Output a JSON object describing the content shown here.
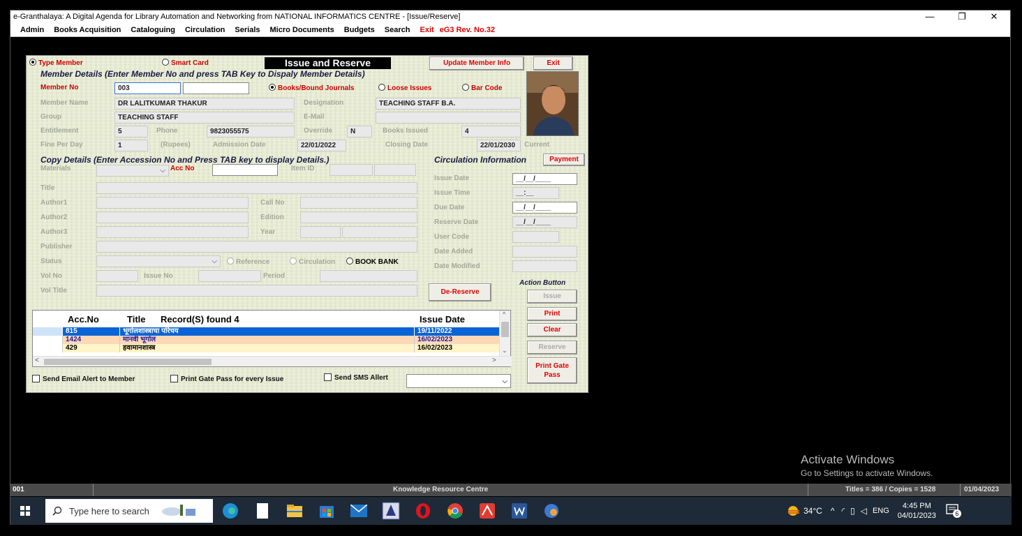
{
  "window": {
    "title": "e-Granthalaya: A Digital Agenda for Library Automation and Networking from NATIONAL INFORMATICS CENTRE - [Issue/Reserve]",
    "controls": [
      "—",
      "❐",
      "✕"
    ]
  },
  "menu": [
    "Admin",
    "Books Acquisition",
    "Cataloguing",
    "Circulation",
    "Serials",
    "Micro Documents",
    "Budgets",
    "Search",
    "Exit",
    "eG3 Rev. No.32"
  ],
  "form": {
    "type_member": "Type Member",
    "smart_card": "Smart Card",
    "banner": "Issue and Reserve",
    "update_member_info": "Update Member Info",
    "exit": "Exit",
    "member_header": "Member Details (Enter Member No and press TAB Key to Dispaly Member Details)",
    "member_no_label": "Member No",
    "member_no": "003",
    "opt_books": "Books/Bound Journals",
    "opt_loose": "Loose Issues",
    "opt_barcode": "Bar Code",
    "member_name_label": "Member Name",
    "member_name": "DR LALITKUMAR THAKUR",
    "designation_label": "Designation",
    "designation": "TEACHING STAFF B.A.",
    "group_label": "Group",
    "group": "TEACHING STAFF",
    "email_label": "E-Mail",
    "entitlement_label": "Entitlement",
    "entitlement": "5",
    "phone_label": "Phone",
    "phone": "9823055575",
    "override_label": "Override",
    "override": "N",
    "books_issued_label": "Books Issued",
    "books_issued": "4",
    "fine_label": "Fine Per Day",
    "fine": "1",
    "rupees_label": "(Rupees)",
    "admission_label": "Admission Date",
    "admission": "22/01/2022",
    "closing_label": "Closing Date",
    "closing": "22/01/2030",
    "current_label": "Current",
    "copy_header": "Copy Details (Enter Accession No and Press TAB key to display Details.)",
    "materials_label": "Materials",
    "acc_no_label": "Acc No",
    "item_id_label": "Item ID",
    "title_label": "Title",
    "author1_label": "Author1",
    "author2_label": "Author2",
    "author3_label": "Author3",
    "call_no_label": "Call No",
    "edition_label": "Edition",
    "year_label": "Year",
    "publisher_label": "Publisher",
    "status_label": "Status",
    "reference_label": "Reference",
    "circulation_label": "Circulation",
    "book_bank_label": "BOOK BANK",
    "vol_no_label": "Vol No",
    "issue_no_label": "Issue No",
    "period_label": "Period",
    "vol_title_label": "Vol Title",
    "circ_header": "Circulation Information",
    "payment": "Payment",
    "issue_date_label": "Issue Date",
    "issue_date": "__/__/____",
    "issue_time_label": "Issue Time",
    "issue_time": "__:__",
    "due_date_label": "Due Date",
    "due_date": "__/__/____",
    "reserve_date_label": "Reserve Date",
    "reserve_date": "__/__/____",
    "user_code_label": "User Code",
    "date_added_label": "Date Added",
    "date_modified_label": "Date Modified",
    "de_reserve": "De-Reserve",
    "action_header": "Action Button",
    "btn_issue": "Issue",
    "btn_print": "Print",
    "btn_clear": "Clear",
    "btn_reserve": "Reserve",
    "btn_print_gate": "Print Gate",
    "btn_pass": "Pass",
    "send_email": "Send Email Alert to Member",
    "print_gate_pass": "Print Gate Pass for every Issue",
    "send_sms": "Send SMS Allert"
  },
  "grid": {
    "col_acc": "Acc.No",
    "col_title": "Title",
    "records": "Record(S) found 4",
    "col_date": "Issue Date",
    "rows": [
      {
        "acc": "815",
        "title": "भूगोलशास्त्राचा परिचय",
        "date": "19/11/2022"
      },
      {
        "acc": "1424",
        "title": "मानवी भूगोल",
        "date": "16/02/2023"
      },
      {
        "acc": "429",
        "title": "हवामानशास्त्र",
        "date": "16/02/2023"
      }
    ]
  },
  "statusbar": {
    "left": "001",
    "center": "Knowledge Resource Centre",
    "titles": "Titles = 386 / Copies = 1528",
    "date": "01/04/2023"
  },
  "watermark": {
    "line1": "Activate Windows",
    "line2": "Go to Settings to activate Windows."
  },
  "taskbar": {
    "search_placeholder": "Type here to search",
    "temp": "34°C",
    "lang": "ENG",
    "time": "4:45 PM",
    "date": "04/01/2023",
    "notif": "6"
  }
}
